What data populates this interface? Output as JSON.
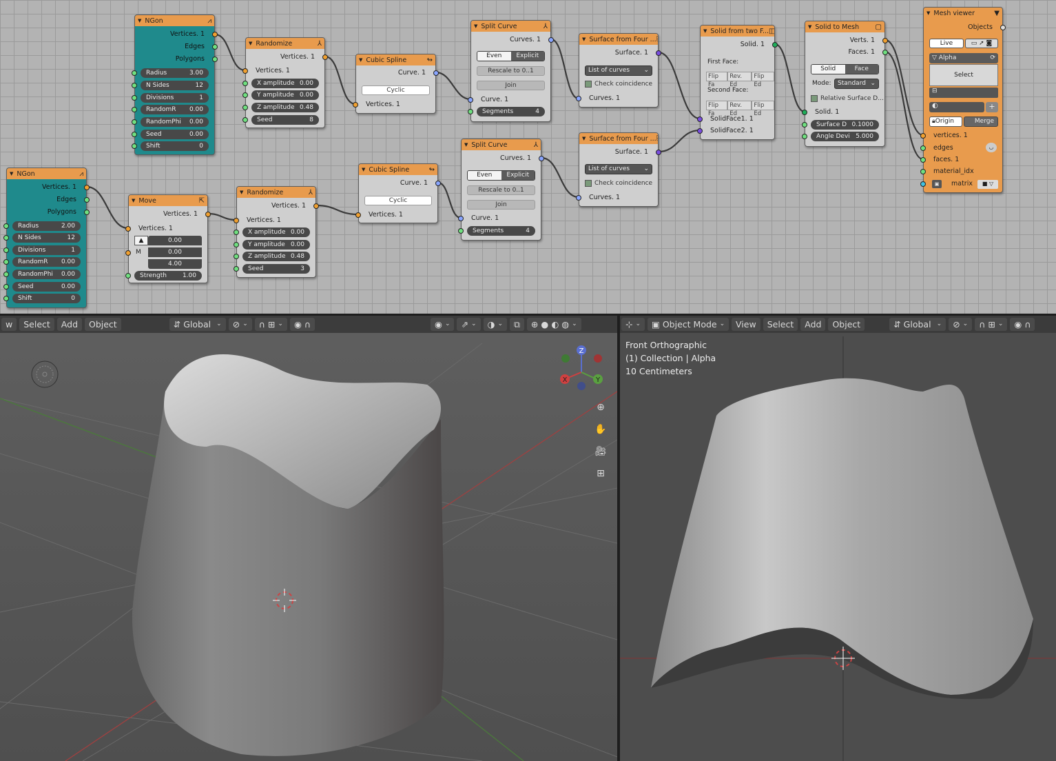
{
  "node_editor": {
    "nodes": {
      "ngon1": {
        "title": "NGon",
        "outputs": [
          "Vertices. 1",
          "Edges",
          "Polygons"
        ],
        "fields": [
          [
            "Radius",
            "3.00"
          ],
          [
            "N Sides",
            "12"
          ],
          [
            "Divisions",
            "1"
          ],
          [
            "RandomR",
            "0.00"
          ],
          [
            "RandomPhi",
            "0.00"
          ],
          [
            "Seed",
            "0.00"
          ],
          [
            "Shift",
            "0"
          ]
        ]
      },
      "ngon2": {
        "title": "NGon",
        "outputs": [
          "Vertices. 1",
          "Edges",
          "Polygons"
        ],
        "fields": [
          [
            "Radius",
            "2.00"
          ],
          [
            "N Sides",
            "12"
          ],
          [
            "Divisions",
            "1"
          ],
          [
            "RandomR",
            "0.00"
          ],
          [
            "RandomPhi",
            "0.00"
          ],
          [
            "Seed",
            "0.00"
          ],
          [
            "Shift",
            "0"
          ]
        ]
      },
      "randomize1": {
        "title": "Randomize",
        "output": "Vertices. 1",
        "input": "Vertices. 1",
        "fields": [
          [
            "X amplitude",
            "0.00"
          ],
          [
            "Y amplitude",
            "0.00"
          ],
          [
            "Z amplitude",
            "0.48"
          ],
          [
            "Seed",
            "8"
          ]
        ]
      },
      "randomize2": {
        "title": "Randomize",
        "output": "Vertices. 1",
        "input": "Vertices. 1",
        "fields": [
          [
            "X amplitude",
            "0.00"
          ],
          [
            "Y amplitude",
            "0.00"
          ],
          [
            "Z amplitude",
            "0.48"
          ],
          [
            "Seed",
            "3"
          ]
        ]
      },
      "move": {
        "title": "Move",
        "output": "Vertices. 1",
        "input": "Vertices. 1",
        "m_label": "M",
        "vec": [
          "0.00",
          "0.00",
          "4.00"
        ],
        "strength_label": "Strength",
        "strength": "1.00"
      },
      "spline1": {
        "title": "Cubic Spline",
        "output": "Curve. 1",
        "cyclic": "Cyclic",
        "input": "Vertices. 1"
      },
      "spline2": {
        "title": "Cubic Spline",
        "output": "Curve. 1",
        "cyclic": "Cyclic",
        "input": "Vertices. 1"
      },
      "split1": {
        "title": "Split Curve",
        "output": "Curves. 1",
        "even": "Even",
        "explicit": "Explicit",
        "rescale": "Rescale to 0..1",
        "join": "Join",
        "input": "Curve. 1",
        "segments_label": "Segments",
        "segments": "4"
      },
      "split2": {
        "title": "Split Curve",
        "output": "Curves. 1",
        "even": "Even",
        "explicit": "Explicit",
        "rescale": "Rescale to 0..1",
        "join": "Join",
        "input": "Curve. 1",
        "segments_label": "Segments",
        "segments": "4"
      },
      "surf1": {
        "title": "Surface from Four ...",
        "output": "Surface. 1",
        "mode": "List of curves",
        "check": "Check coincidence",
        "input": "Curves. 1"
      },
      "surf2": {
        "title": "Surface from Four ...",
        "output": "Surface. 1",
        "mode": "List of curves",
        "check": "Check coincidence",
        "input": "Curves. 1"
      },
      "solid2f": {
        "title": "Solid from two F...",
        "output": "Solid. 1",
        "first": "First Face:",
        "second": "Second Face:",
        "flips": [
          "Flip Fa",
          "Rev. Ed",
          "Flip Ed"
        ],
        "in1": "SolidFace1. 1",
        "in2": "SolidFace2. 1"
      },
      "solid2mesh": {
        "title": "Solid to Mesh",
        "out1": "Verts. 1",
        "out2": "Faces. 1",
        "solid": "Solid",
        "face": "Face",
        "mode_label": "Mode:",
        "mode": "Standard",
        "relative": "Relative Surface D...",
        "input": "Solid. 1",
        "surf_label": "Surface D",
        "surf_val": "0.1000",
        "angle_label": "Angle Devi",
        "angle_val": "5.000"
      },
      "viewer": {
        "title": "Mesh viewer",
        "objects": "Objects",
        "live": "Live",
        "alpha": "Alpha",
        "select": "Select",
        "origin": "Origin",
        "merge": "Merge",
        "inputs": [
          "vertices. 1",
          "edges",
          "faces. 1",
          "material_idx",
          "matrix"
        ]
      }
    }
  },
  "viewport_left": {
    "menu": [
      "w",
      "Select",
      "Add",
      "Object"
    ],
    "orientation": "Global",
    "gizmo": {
      "z": "Z",
      "x": "X",
      "y": "Y"
    }
  },
  "viewport_right": {
    "mode": "Object Mode",
    "menu": [
      "View",
      "Select",
      "Add",
      "Object"
    ],
    "orientation": "Global",
    "info": [
      "Front Orthographic",
      "(1) Collection | Alpha",
      "10 Centimeters"
    ]
  },
  "colors": {
    "node_header": "#e89b4d",
    "ngon_body": "#1f8a8c",
    "grid_bg": "#b3b3b3"
  }
}
